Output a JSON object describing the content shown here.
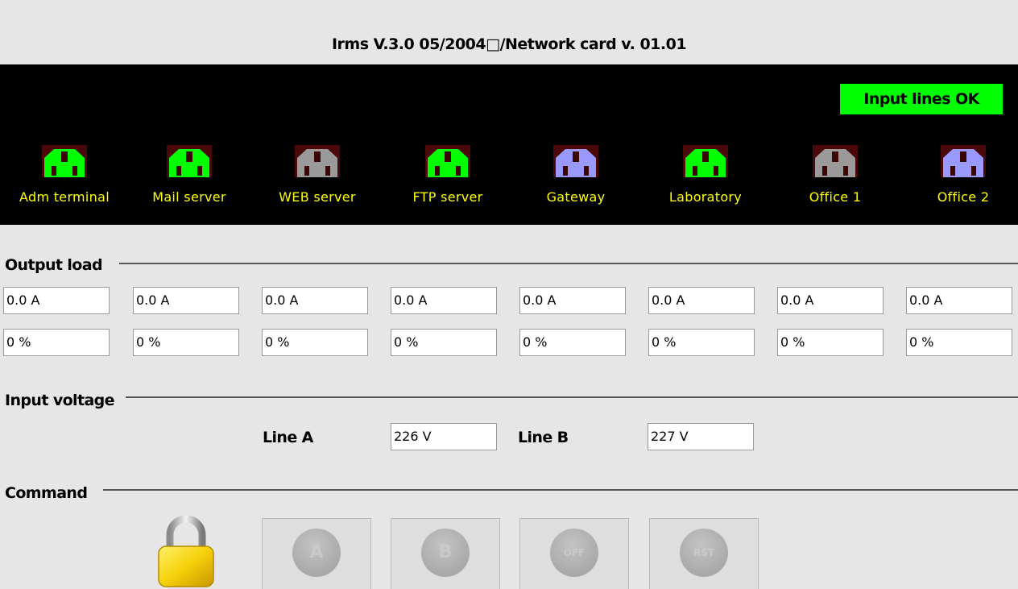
{
  "header": {
    "title": "Irms V.3.0 05/2004□/Network card v. 01.01"
  },
  "status": {
    "label": "Input lines OK",
    "color": "#00ff00"
  },
  "outlets": [
    {
      "label": "Adm terminal",
      "state_color": "#00ff00"
    },
    {
      "label": "Mail server",
      "state_color": "#00ff00"
    },
    {
      "label": "WEB server",
      "state_color": "#9a9a9a"
    },
    {
      "label": "FTP server",
      "state_color": "#00ff00"
    },
    {
      "label": "Gateway",
      "state_color": "#9999ff"
    },
    {
      "label": "Laboratory",
      "state_color": "#00ff00"
    },
    {
      "label": "Office 1",
      "state_color": "#9a9a9a"
    },
    {
      "label": "Office 2",
      "state_color": "#9999ff"
    }
  ],
  "output_load": {
    "section_label": "Output load",
    "current": [
      "0.0 A",
      "0.0 A",
      "0.0 A",
      "0.0 A",
      "0.0 A",
      "0.0 A",
      "0.0 A",
      "0.0 A"
    ],
    "percent": [
      "0 %",
      "0 %",
      "0 %",
      "0 %",
      "0 %",
      "0 %",
      "0 %",
      "0 %"
    ]
  },
  "input_voltage": {
    "section_label": "Input voltage",
    "line_a_label": "Line A",
    "line_a_value": "226 V",
    "line_b_label": "Line B",
    "line_b_value": "227 V"
  },
  "command": {
    "section_label": "Command",
    "lock_icon": "padlock-icon",
    "buttons": [
      {
        "label": "A"
      },
      {
        "label": "B"
      },
      {
        "label": "OFF"
      },
      {
        "label": "RST"
      }
    ]
  },
  "colors": {
    "panel_bg": "#000000",
    "outlet_label": "#ffff00",
    "socket_frame": "#4a0808"
  }
}
